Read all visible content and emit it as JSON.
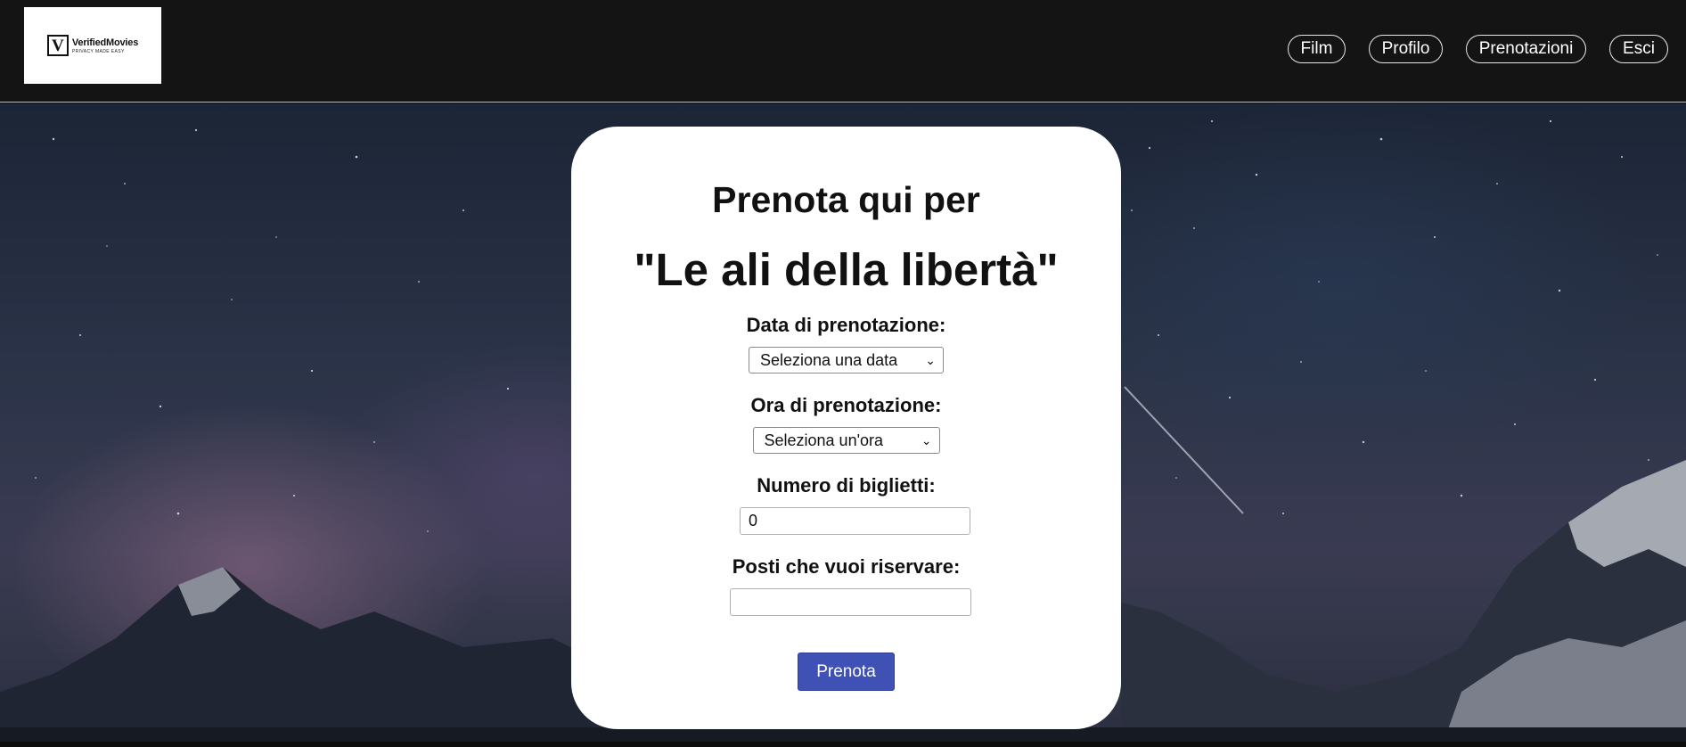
{
  "logo": {
    "name": "VerifiedMovies",
    "tagline": "PRIVACY MADE EASY",
    "mark": "V"
  },
  "nav": [
    {
      "label": "Film"
    },
    {
      "label": "Profilo"
    },
    {
      "label": "Prenotazioni"
    },
    {
      "label": "Esci"
    }
  ],
  "card": {
    "title": "Prenota qui per",
    "movie": "\"Le ali della libertà\""
  },
  "form": {
    "date_label": "Data di prenotazione:",
    "date_value": "Seleziona una data",
    "time_label": "Ora di prenotazione:",
    "time_value": "Seleziona un'ora",
    "tickets_label": "Numero di biglietti:",
    "tickets_value": "0",
    "seats_label": "Posti che vuoi riservare:",
    "seats_value": "",
    "submit_label": "Prenota"
  },
  "colors": {
    "header_bg": "#141414",
    "accent": "#3f51b5",
    "card_bg": "#ffffff"
  },
  "icons": {
    "select_chevron": "chevron-down-icon"
  }
}
